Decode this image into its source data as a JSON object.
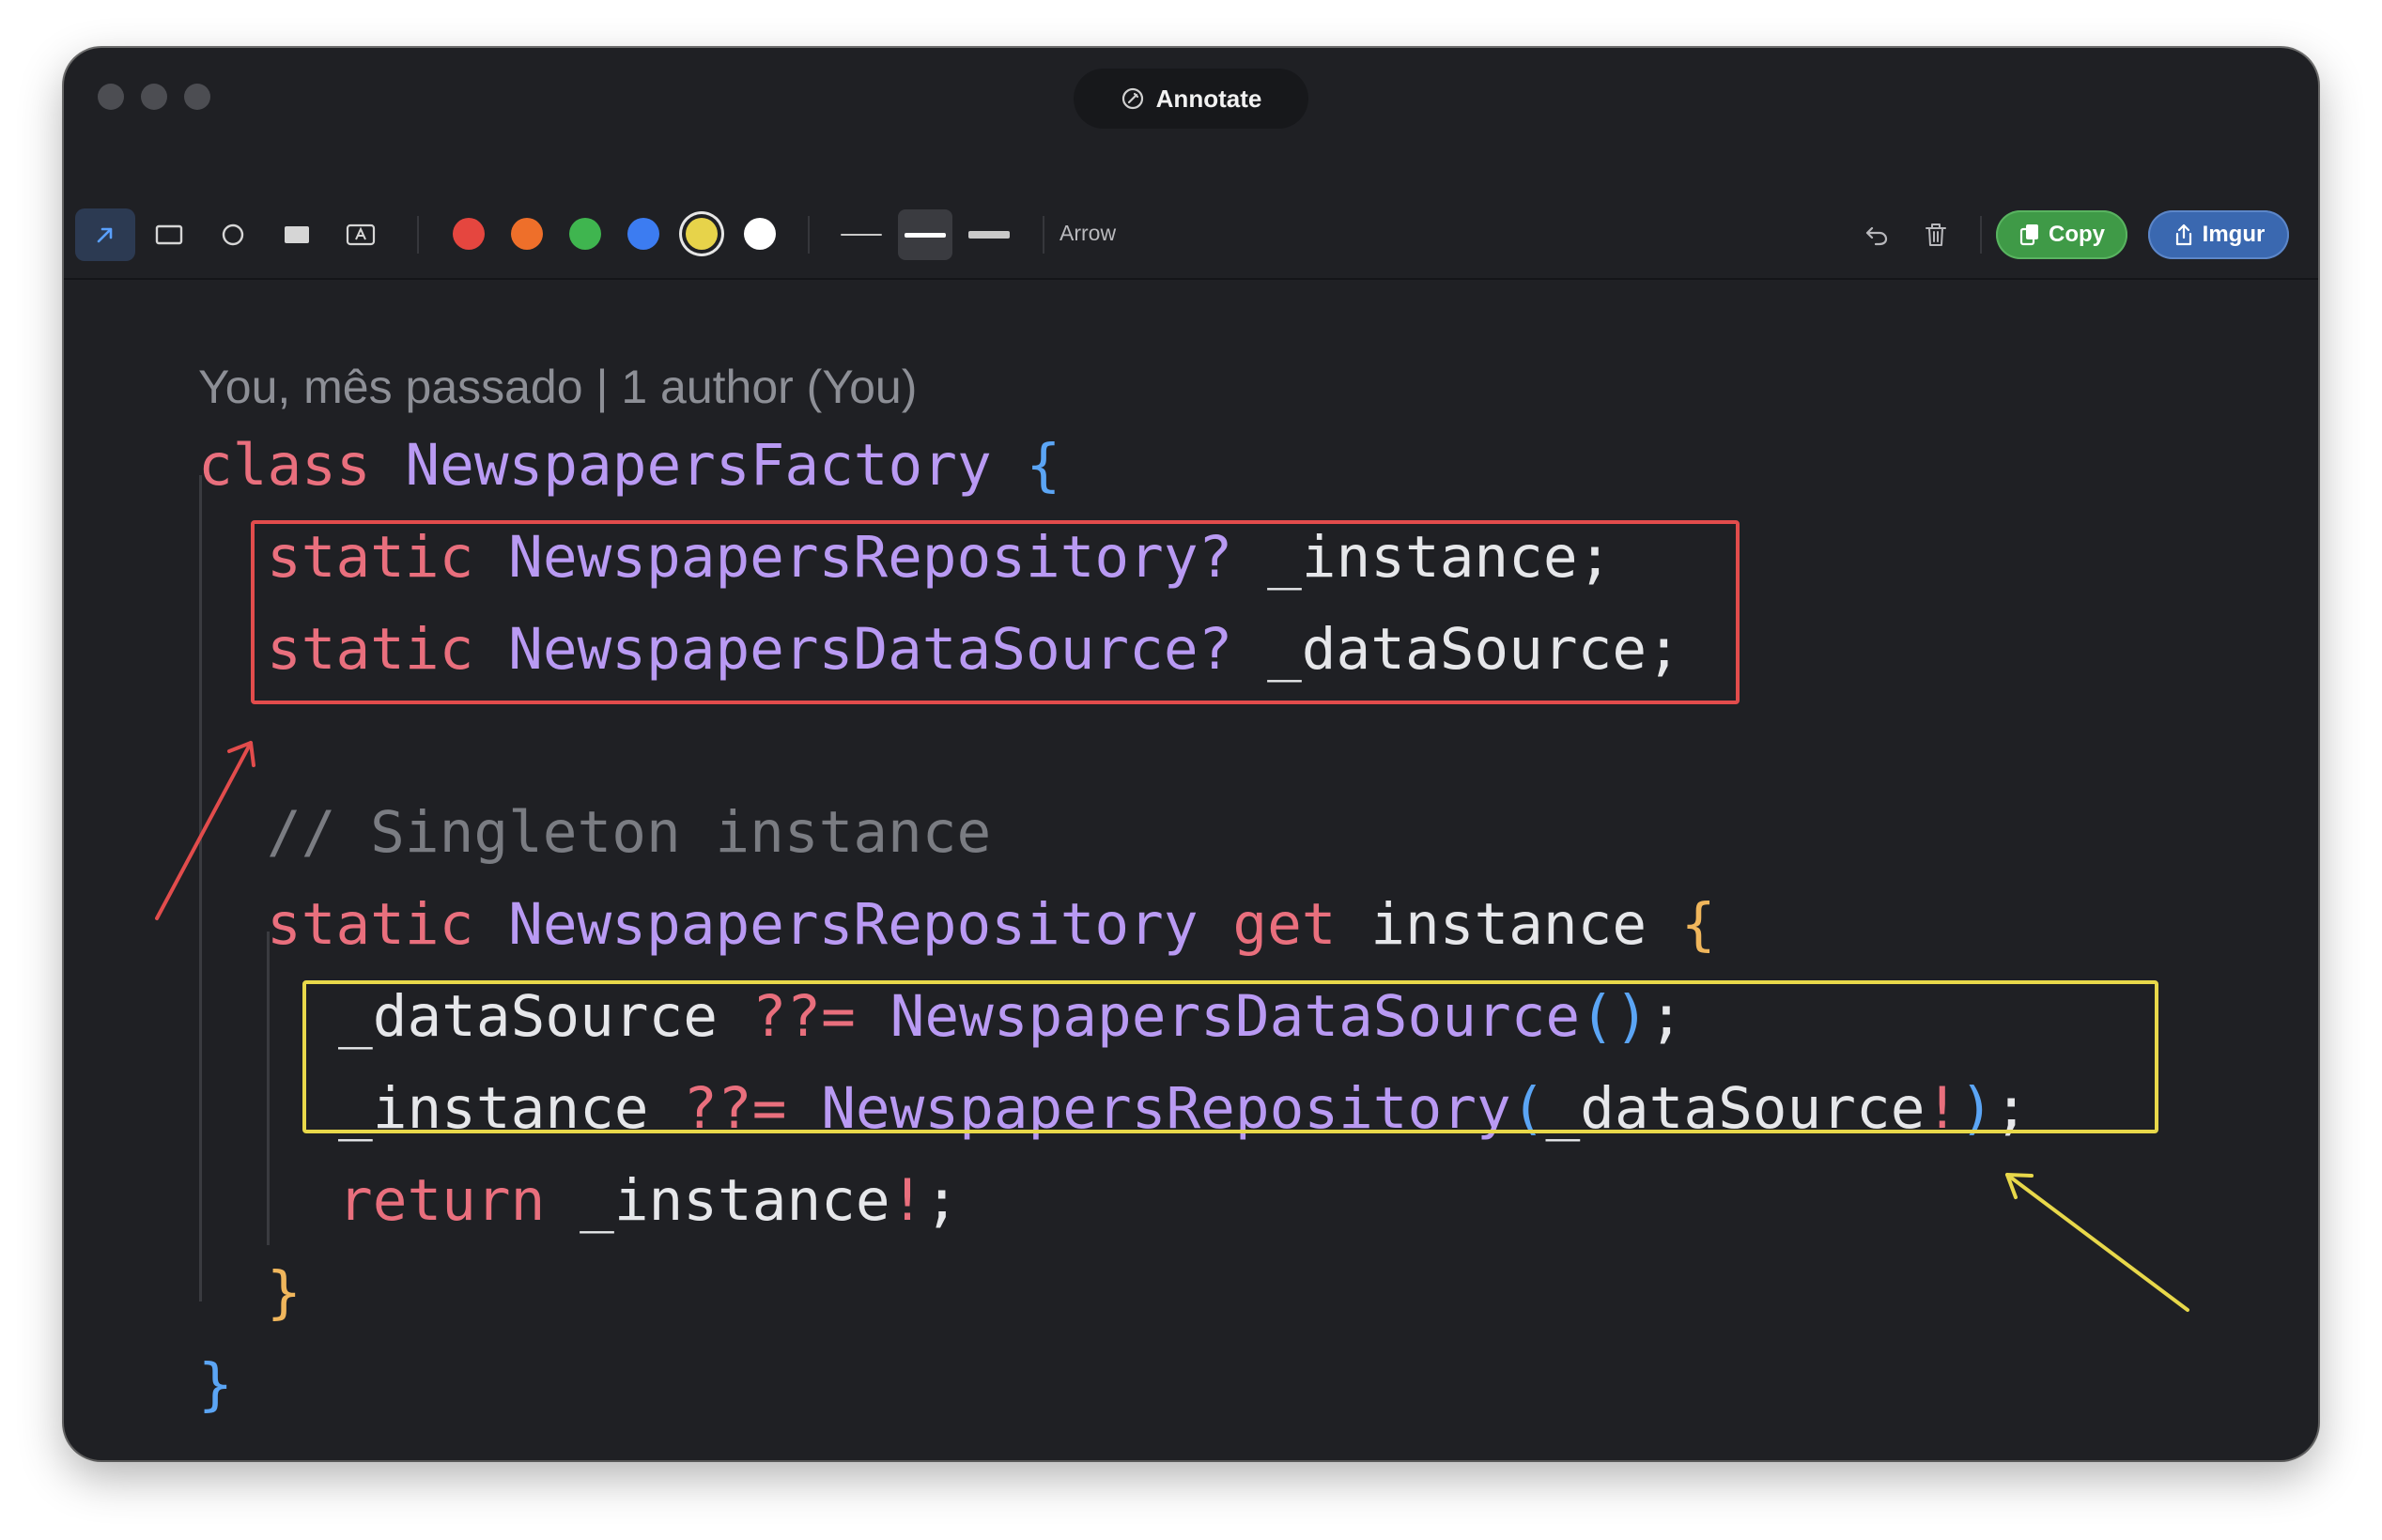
{
  "window": {
    "title": "Annotate"
  },
  "toolbar": {
    "tools": [
      {
        "name": "arrow-tool",
        "icon": "arrow-icon",
        "active": true
      },
      {
        "name": "rectangle-tool",
        "icon": "rectangle-icon"
      },
      {
        "name": "ellipse-tool",
        "icon": "circle-icon"
      },
      {
        "name": "filled-rectangle-tool",
        "icon": "filled-rectangle-icon"
      },
      {
        "name": "text-tool",
        "icon": "text-icon"
      }
    ],
    "colors": [
      {
        "name": "red",
        "hex": "#e5463f"
      },
      {
        "name": "orange",
        "hex": "#ee6f2a"
      },
      {
        "name": "green",
        "hex": "#3fb54f"
      },
      {
        "name": "blue",
        "hex": "#3c7cf1"
      },
      {
        "name": "yellow",
        "hex": "#e7d34a",
        "selected": true
      },
      {
        "name": "white",
        "hex": "#ffffff"
      }
    ],
    "stroke_widths": [
      "thin",
      "medium",
      "thick"
    ],
    "active_stroke": "medium",
    "tool_label": "Arrow",
    "undo_icon": "undo-icon",
    "delete_icon": "trash-icon",
    "copy_label": "Copy",
    "imgur_label": "Imgur",
    "copy_color": "#3f9a47",
    "imgur_color": "#3a68b0"
  },
  "code": {
    "blame": "You, mês passado | 1 author (You)",
    "lines": [
      {
        "parts": [
          "class",
          "NewspapersFactory",
          "{"
        ]
      },
      {
        "parts": [
          "static",
          "NewspapersRepository?",
          "_instance;"
        ]
      },
      {
        "parts": [
          "static",
          "NewspapersDataSource?",
          "_dataSource;"
        ]
      },
      {
        "parts": [
          "// Singleton instance"
        ]
      },
      {
        "parts": [
          "static",
          "NewspapersRepository",
          "get",
          "instance",
          "{"
        ]
      },
      {
        "parts": [
          "_dataSource",
          "??=",
          "NewspapersDataSource",
          "()",
          ";"
        ]
      },
      {
        "parts": [
          "_instance",
          "??=",
          "NewspapersRepository",
          "(",
          "_dataSource",
          "!",
          ")",
          ";"
        ]
      },
      {
        "parts": [
          "return",
          "_instance",
          "!",
          ";"
        ]
      },
      {
        "parts": [
          "}"
        ]
      },
      {
        "parts": [
          "}"
        ]
      }
    ]
  },
  "annotations": [
    {
      "type": "rectangle",
      "color": "#e24c4c"
    },
    {
      "type": "arrow",
      "color": "#e24c4c"
    },
    {
      "type": "rectangle",
      "color": "#e8d84a"
    },
    {
      "type": "arrow",
      "color": "#e8d84a"
    }
  ]
}
